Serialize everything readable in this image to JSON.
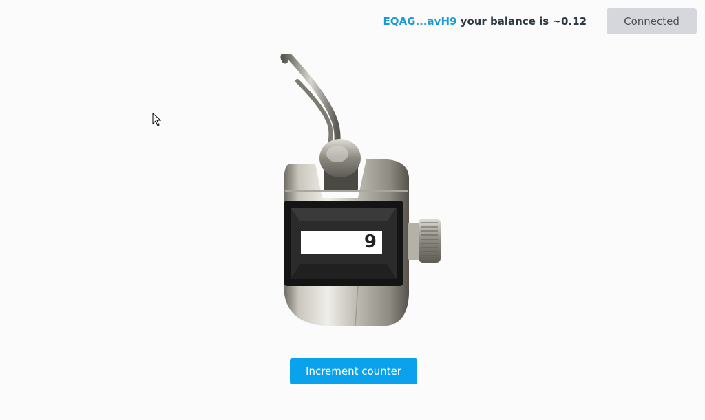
{
  "header": {
    "wallet_address": "EQAG...avH9",
    "balance_text": " your balance is ~0.12",
    "connect_label": "Connected"
  },
  "counter": {
    "value": "9"
  },
  "actions": {
    "increment_label": "Increment counter"
  },
  "colors": {
    "accent": "#0aa2ec",
    "address": "#1a9ad6",
    "connected_bg": "#d5d7dc"
  },
  "icons": {
    "cursor": "mouse-pointer-icon",
    "device": "tally-counter-image"
  }
}
